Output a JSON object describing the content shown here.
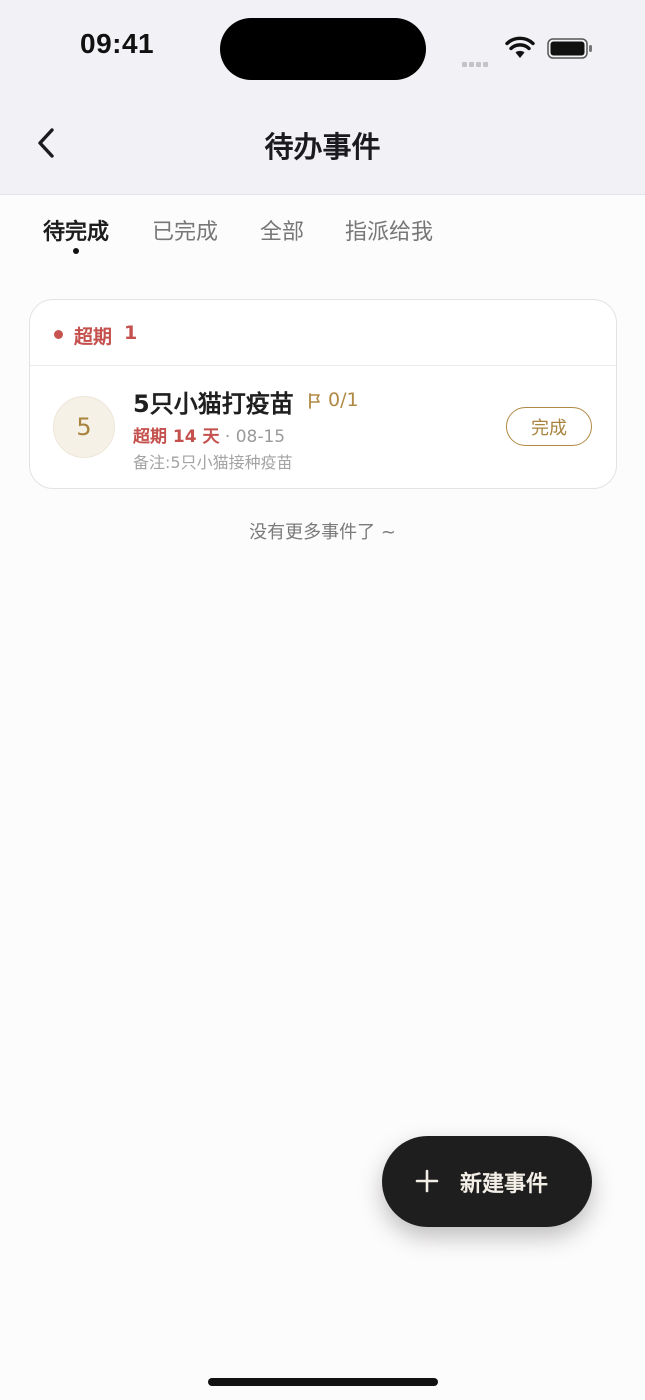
{
  "status_bar": {
    "time": "09:41"
  },
  "nav": {
    "title": "待办事件",
    "back_icon": "chevron-left-icon"
  },
  "tabs": [
    {
      "label": "待完成",
      "active": true
    },
    {
      "label": "已完成",
      "active": false
    },
    {
      "label": "全部",
      "active": false
    },
    {
      "label": "指派给我",
      "active": false
    }
  ],
  "group": {
    "label": "超期",
    "count": "1",
    "color": "#c4514e"
  },
  "item": {
    "avatar_text": "5",
    "title": "5只小猫打疫苗",
    "progress": "0/1",
    "overdue_text": "超期 14 天",
    "separator": "·",
    "date": "08-15",
    "note": "备注:5只小猫接种疫苗",
    "done_label": "完成"
  },
  "footer": {
    "no_more": "没有更多事件了 ~"
  },
  "fab": {
    "label": "新建事件",
    "icon": "plus-icon"
  },
  "colors": {
    "accent": "#b08a45",
    "danger": "#c4514e",
    "fab_bg": "#1e1e1e"
  }
}
